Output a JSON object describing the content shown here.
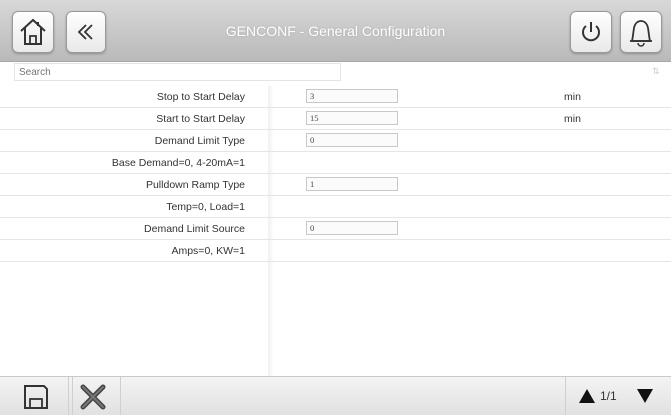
{
  "header": {
    "title": "GENCONF - General Configuration",
    "home_icon": "home-icon",
    "back_icon": "chevron-double-left-icon",
    "power_icon": "power-icon",
    "alarm_icon": "bell-icon"
  },
  "search": {
    "placeholder": "Search",
    "value": ""
  },
  "rows": [
    {
      "label": "Stop to Start Delay",
      "value": "3",
      "unit": "min"
    },
    {
      "label": "Start to Start Delay",
      "value": "15",
      "unit": "min"
    },
    {
      "label": "Demand Limit Type",
      "value": "0",
      "unit": ""
    },
    {
      "label": "Base Demand=0, 4-20mA=1"
    },
    {
      "label": "Pulldown Ramp Type",
      "value": "1",
      "unit": ""
    },
    {
      "label": "Temp=0, Load=1"
    },
    {
      "label": "Demand Limit Source",
      "value": "0",
      "unit": ""
    },
    {
      "label": "Amps=0, KW=1"
    }
  ],
  "footer": {
    "save_icon": "save-icon",
    "cancel_icon": "cancel-x-icon",
    "page_indicator": "1/1"
  }
}
